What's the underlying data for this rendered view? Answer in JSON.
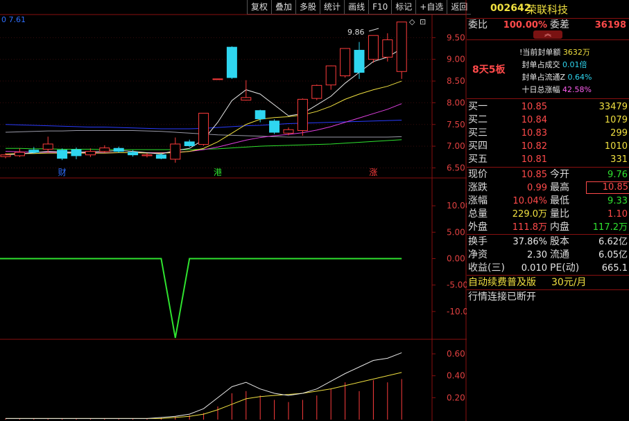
{
  "toolbar": [
    "复权",
    "叠加",
    "多股",
    "统计",
    "画线",
    "F10",
    "标记",
    "+自选",
    "返回"
  ],
  "chart": {
    "corner_value": "0 7.61",
    "max_label": "9.86",
    "price_ticks": [
      "9.50",
      "9.00",
      "8.50",
      "8.00",
      "7.50",
      "7.00",
      "6.50"
    ],
    "price_tick_values": [
      9.5,
      9.0,
      8.5,
      8.0,
      7.5,
      7.0,
      6.5
    ],
    "event_markers": [
      "财",
      "港",
      "涨"
    ],
    "indicator_ticks": [
      "10.00",
      "5.00",
      "0.00",
      "-5.00",
      "-10.00"
    ],
    "indicator_tick_values": [
      10,
      5,
      0,
      -5,
      -10
    ],
    "volume_ticks": [
      "0.60",
      "0.40",
      "0.20"
    ],
    "volume_tick_values": [
      0.6,
      0.4,
      0.2
    ]
  },
  "chart_data": {
    "type": "candlestick",
    "price_range": [
      6.3,
      10.0
    ],
    "candles": [
      {
        "o": 6.76,
        "c": 6.8,
        "h": 6.84,
        "l": 6.72,
        "up": true
      },
      {
        "o": 6.78,
        "c": 6.86,
        "h": 6.95,
        "l": 6.75,
        "up": true
      },
      {
        "o": 6.86,
        "c": 6.91,
        "h": 6.98,
        "l": 6.83,
        "up": false
      },
      {
        "o": 6.93,
        "c": 7.05,
        "h": 7.22,
        "l": 6.85,
        "up": true
      },
      {
        "o": 6.91,
        "c": 6.72,
        "h": 6.95,
        "l": 6.68,
        "up": false
      },
      {
        "o": 6.92,
        "c": 6.78,
        "h": 6.97,
        "l": 6.7,
        "up": false
      },
      {
        "o": 6.8,
        "c": 6.88,
        "h": 6.95,
        "l": 6.75,
        "up": true
      },
      {
        "o": 6.88,
        "c": 6.96,
        "h": 7.02,
        "l": 6.85,
        "up": true
      },
      {
        "o": 6.95,
        "c": 6.88,
        "h": 6.99,
        "l": 6.85,
        "up": false
      },
      {
        "o": 6.86,
        "c": 6.8,
        "h": 6.91,
        "l": 6.76,
        "up": false
      },
      {
        "o": 6.78,
        "c": 6.8,
        "h": 6.84,
        "l": 6.74,
        "up": true
      },
      {
        "o": 6.8,
        "c": 6.72,
        "h": 6.84,
        "l": 6.7,
        "up": false
      },
      {
        "o": 6.7,
        "c": 7.05,
        "h": 7.2,
        "l": 6.62,
        "up": true
      },
      {
        "o": 7.1,
        "c": 7.01,
        "h": 7.15,
        "l": 6.98,
        "up": false
      },
      {
        "o": 7.04,
        "c": 7.76,
        "h": 7.76,
        "l": 7.01,
        "up": true
      },
      {
        "o": 8.55,
        "c": 8.55,
        "h": 8.55,
        "l": 8.55,
        "up": true
      },
      {
        "o": 9.28,
        "c": 8.58,
        "h": 9.3,
        "l": 8.55,
        "up": false
      },
      {
        "o": 8.12,
        "c": 8.06,
        "h": 8.52,
        "l": 8.05,
        "up": true
      },
      {
        "o": 7.82,
        "c": 7.63,
        "h": 7.84,
        "l": 7.55,
        "up": false
      },
      {
        "o": 7.58,
        "c": 7.32,
        "h": 7.62,
        "l": 7.28,
        "up": false
      },
      {
        "o": 7.3,
        "c": 7.38,
        "h": 7.43,
        "l": 7.25,
        "up": true
      },
      {
        "o": 7.36,
        "c": 8.08,
        "h": 8.1,
        "l": 7.24,
        "up": true
      },
      {
        "o": 8.1,
        "c": 8.4,
        "h": 8.42,
        "l": 8.06,
        "up": true
      },
      {
        "o": 8.41,
        "c": 8.85,
        "h": 8.86,
        "l": 8.3,
        "up": true
      },
      {
        "o": 8.62,
        "c": 9.25,
        "h": 9.25,
        "l": 8.58,
        "up": true
      },
      {
        "o": 9.21,
        "c": 8.7,
        "h": 9.4,
        "l": 8.55,
        "up": false
      },
      {
        "o": 9.0,
        "c": 9.55,
        "h": 9.55,
        "l": 8.92,
        "up": true
      },
      {
        "o": 9.05,
        "c": 9.45,
        "h": 9.6,
        "l": 8.95,
        "up": true
      },
      {
        "o": 8.72,
        "c": 9.86,
        "h": 9.86,
        "l": 8.55,
        "up": true
      }
    ],
    "ma_white": [
      6.8,
      6.82,
      6.85,
      6.88,
      6.87,
      6.86,
      6.87,
      6.88,
      6.9,
      6.88,
      6.85,
      6.82,
      6.9,
      6.95,
      7.15,
      7.55,
      8.05,
      8.3,
      8.2,
      7.95,
      7.7,
      7.75,
      7.95,
      8.15,
      8.45,
      8.7,
      8.95,
      9.05,
      9.25
    ],
    "ma_yellow": [
      6.82,
      6.83,
      6.83,
      6.84,
      6.84,
      6.84,
      6.84,
      6.84,
      6.85,
      6.85,
      6.84,
      6.84,
      6.85,
      6.88,
      6.95,
      7.1,
      7.3,
      7.5,
      7.62,
      7.66,
      7.68,
      7.72,
      7.8,
      7.92,
      8.08,
      8.2,
      8.3,
      8.38,
      8.5
    ],
    "ma_magenta": [
      6.88,
      6.87,
      6.86,
      6.86,
      6.85,
      6.85,
      6.85,
      6.85,
      6.85,
      6.85,
      6.85,
      6.85,
      6.86,
      6.88,
      6.92,
      6.98,
      7.06,
      7.14,
      7.2,
      7.24,
      7.27,
      7.31,
      7.37,
      7.45,
      7.55,
      7.65,
      7.75,
      7.85,
      7.98
    ],
    "ma_green": [
      6.95,
      6.95,
      6.94,
      6.94,
      6.93,
      6.93,
      6.93,
      6.92,
      6.92,
      6.92,
      6.92,
      6.92,
      6.92,
      6.92,
      6.93,
      6.94,
      6.96,
      6.98,
      7.0,
      7.01,
      7.02,
      7.03,
      7.04,
      7.05,
      7.07,
      7.09,
      7.11,
      7.13,
      7.15
    ],
    "line_blue": [
      7.5,
      7.49,
      7.48,
      7.47,
      7.46,
      7.45,
      7.44,
      7.44,
      7.43,
      7.42,
      7.41,
      7.4,
      7.4,
      7.4,
      7.41,
      7.43,
      7.45,
      7.47,
      7.48,
      7.5,
      7.52,
      7.53,
      7.54,
      7.55,
      7.56,
      7.57,
      7.58,
      7.59,
      7.6
    ],
    "line_grey": [
      7.32,
      7.33,
      7.34,
      7.35,
      7.35,
      7.36,
      7.36,
      7.36,
      7.36,
      7.36,
      7.35,
      7.34,
      7.32,
      7.3,
      7.28,
      7.26,
      7.25,
      7.24,
      7.23,
      7.22,
      7.21,
      7.21,
      7.21,
      7.21,
      7.21,
      7.21,
      7.21,
      7.21,
      7.22
    ],
    "indicator_range": [
      -15,
      15
    ],
    "indicator_values": [
      0,
      0,
      0,
      0,
      0,
      0,
      0,
      0,
      0,
      0,
      0,
      0,
      -15,
      0,
      0,
      0,
      0,
      0,
      0,
      0,
      0,
      0,
      0,
      0,
      0,
      0,
      0,
      0,
      0
    ],
    "volume_range": [
      0,
      0.72
    ],
    "volume_bars": [
      0.01,
      0.01,
      0.01,
      0.01,
      0.01,
      0.01,
      0.01,
      0.01,
      0.01,
      0.01,
      0.01,
      0.02,
      0.03,
      0.04,
      0.06,
      0.12,
      0.24,
      0.26,
      0.22,
      0.18,
      0.16,
      0.18,
      0.22,
      0.28,
      0.34,
      0.26,
      0.36,
      0.34,
      0.37
    ],
    "volume_white": [
      0.01,
      0.01,
      0.01,
      0.01,
      0.01,
      0.01,
      0.01,
      0.01,
      0.01,
      0.01,
      0.01,
      0.02,
      0.03,
      0.05,
      0.1,
      0.2,
      0.3,
      0.34,
      0.28,
      0.24,
      0.22,
      0.24,
      0.28,
      0.35,
      0.42,
      0.48,
      0.54,
      0.56,
      0.61
    ],
    "volume_yellow": [
      0.01,
      0.01,
      0.01,
      0.01,
      0.01,
      0.01,
      0.01,
      0.01,
      0.01,
      0.01,
      0.01,
      0.01,
      0.02,
      0.03,
      0.05,
      0.09,
      0.14,
      0.19,
      0.21,
      0.22,
      0.23,
      0.24,
      0.26,
      0.28,
      0.31,
      0.34,
      0.37,
      0.4,
      0.43
    ]
  },
  "panel": {
    "code": "002642",
    "name": "荣联科技",
    "weibi_label": "委比",
    "weibi_value": "100.00%",
    "weicha_label": "委差",
    "weicha_value": "36198",
    "limit_streak": "8天5板",
    "limit_info": [
      {
        "label": "当前封单额",
        "value": "3632万"
      },
      {
        "label": "封单占成交",
        "value": "0.01倍"
      },
      {
        "label": "封单占流通Z",
        "value": "0.64%"
      },
      {
        "label": "十日总涨幅",
        "value": "42.58%"
      }
    ],
    "bids": [
      {
        "label": "买一",
        "price": "10.85",
        "vol": "33479"
      },
      {
        "label": "买二",
        "price": "10.84",
        "vol": "1079"
      },
      {
        "label": "买三",
        "price": "10.83",
        "vol": "299"
      },
      {
        "label": "买四",
        "price": "10.82",
        "vol": "1010"
      },
      {
        "label": "买五",
        "price": "10.81",
        "vol": "331"
      }
    ],
    "quote": [
      {
        "l1": "现价",
        "v1": "10.85",
        "l2": "今开",
        "v2": "9.76"
      },
      {
        "l1": "涨跌",
        "v1": "0.99",
        "l2": "最高",
        "v2": "10.85"
      },
      {
        "l1": "涨幅",
        "v1": "10.04%",
        "l2": "最低",
        "v2": "9.33"
      },
      {
        "l1": "总量",
        "v1": "229.0万",
        "l2": "量比",
        "v2": "1.10"
      },
      {
        "l1": "外盘",
        "v1": "111.8万",
        "l2": "内盘",
        "v2": "117.2万"
      }
    ],
    "stats": [
      {
        "l1": "换手",
        "v1": "37.86%",
        "l2": "股本",
        "v2": "6.62亿"
      },
      {
        "l1": "净资",
        "v1": "2.30",
        "l2": "流通",
        "v2": "6.05亿"
      },
      {
        "l1": "收益(三)",
        "v1": "0.010",
        "l2": "PE(动)",
        "v2": "665.1"
      }
    ],
    "promo_text": "自动续费普及版",
    "promo_price": "30元/月",
    "status": "行情连接已断开"
  }
}
